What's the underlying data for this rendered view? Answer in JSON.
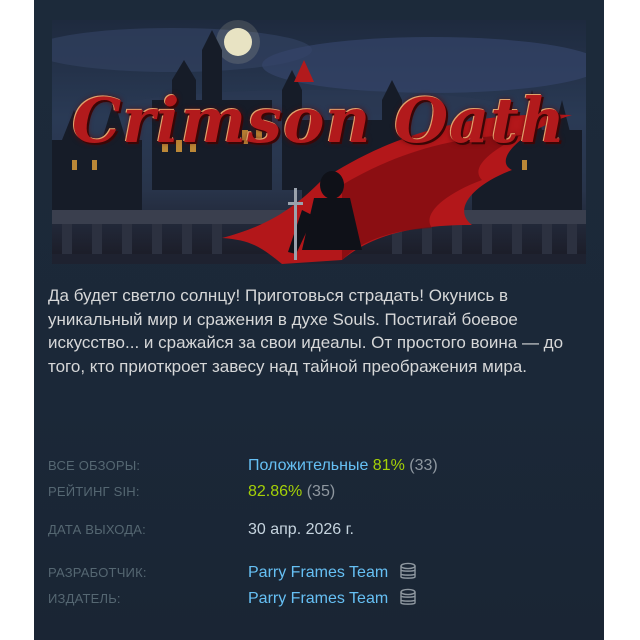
{
  "capsule": {
    "logo_text": "Crimson Oath"
  },
  "description": "Да будет светло солнцу! Приготовься страдать! Окунись в уникальный мир и сражения в духе Souls. Постигай боевое искусство... и сражайся за свои идеалы. От простого воина — до того, кто приоткроет завесу над тайной преображения мира.",
  "reviews": {
    "label": "ВСЕ ОБЗОРЫ:",
    "summary": "Положительные",
    "percent": "81%",
    "count": "(33)"
  },
  "sih_rating": {
    "label": "РЕЙТИНГ SIH:",
    "percent": "82.86%",
    "count": "(35)"
  },
  "release": {
    "label": "ДАТА ВЫХОДА:",
    "date": "30 апр. 2026 г."
  },
  "developer": {
    "label": "РАЗРАБОТЧИК:",
    "name": "Parry Frames Team",
    "icon": "coins-stack-icon"
  },
  "publisher": {
    "label": "ИЗДАТЕЛЬ:",
    "name": "Parry Frames Team",
    "icon": "coins-stack-icon"
  },
  "colors": {
    "panel_bg": "#1b2838",
    "link": "#66c0f4",
    "positive_green": "#a4d007",
    "label_gray": "#556772",
    "logo_red": "#b21a1c"
  }
}
